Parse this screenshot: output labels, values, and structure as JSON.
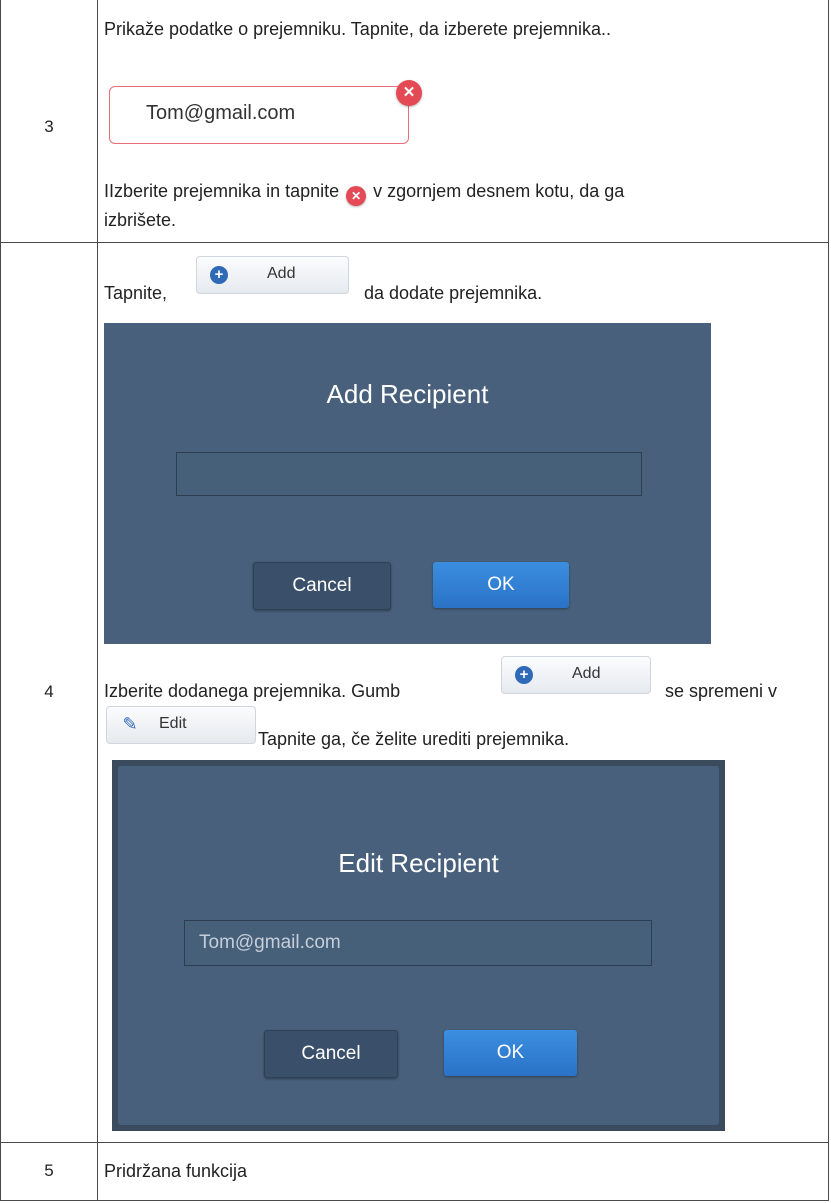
{
  "rows": [
    {
      "number": "3",
      "text_1": "Prikaže podatke o prejemniku. Tapnite, da izberete prejemnika..",
      "chip_value": "Tom@gmail.com",
      "text_2a": "IIzberite prejemnika in tapnite",
      "text_2b": "v zgornjem desnem kotu, da ga",
      "text_2c": "izbrišete."
    },
    {
      "number": "4",
      "text_1a": "Tapnite,",
      "add_button_label": "Add",
      "text_1b": "da dodate prejemnika.",
      "add_dialog": {
        "title": "Add Recipient",
        "input_value": "",
        "cancel_label": "Cancel",
        "ok_label": "OK"
      },
      "text_2a": "Izberite dodanega prejemnika. Gumb",
      "add_button_label_2": "Add",
      "text_2b": "se spremeni v",
      "edit_button_label": "Edit",
      "text_2c": "Tapnite ga, če želite urediti prejemnika.",
      "edit_dialog": {
        "title": "Edit Recipient",
        "input_value": "Tom@gmail.com",
        "cancel_label": "Cancel",
        "ok_label": "OK"
      }
    },
    {
      "number": "5",
      "text": "Pridržana funkcija"
    }
  ],
  "colors": {
    "dialog_bg": "#48607b",
    "ok_button": "#2f7fd4",
    "delete_badge": "#e34a55"
  },
  "icons": [
    "delete-badge-icon",
    "plus-circle-icon",
    "edit-pencil-icon"
  ]
}
